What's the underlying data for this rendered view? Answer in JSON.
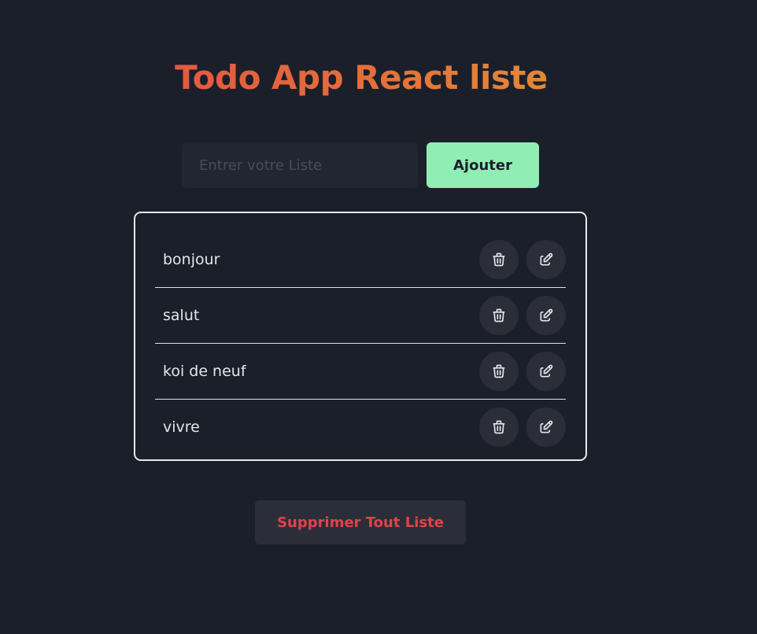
{
  "header": {
    "title": "Todo App React liste"
  },
  "form": {
    "placeholder": "Entrer votre Liste",
    "value": "",
    "add_label": "Ajouter"
  },
  "todos": [
    {
      "text": "bonjour"
    },
    {
      "text": "salut"
    },
    {
      "text": "koi de neuf"
    },
    {
      "text": "vivre"
    }
  ],
  "icons": {
    "delete": "trash-icon",
    "edit": "edit-icon"
  },
  "footer": {
    "clear_label": "Supprimer Tout Liste"
  },
  "colors": {
    "background": "#1b1f2a",
    "accent_green": "#90edb3",
    "danger_red": "#e0434a",
    "title_gradient_start": "#e34545",
    "title_gradient_end": "#e0a238"
  }
}
